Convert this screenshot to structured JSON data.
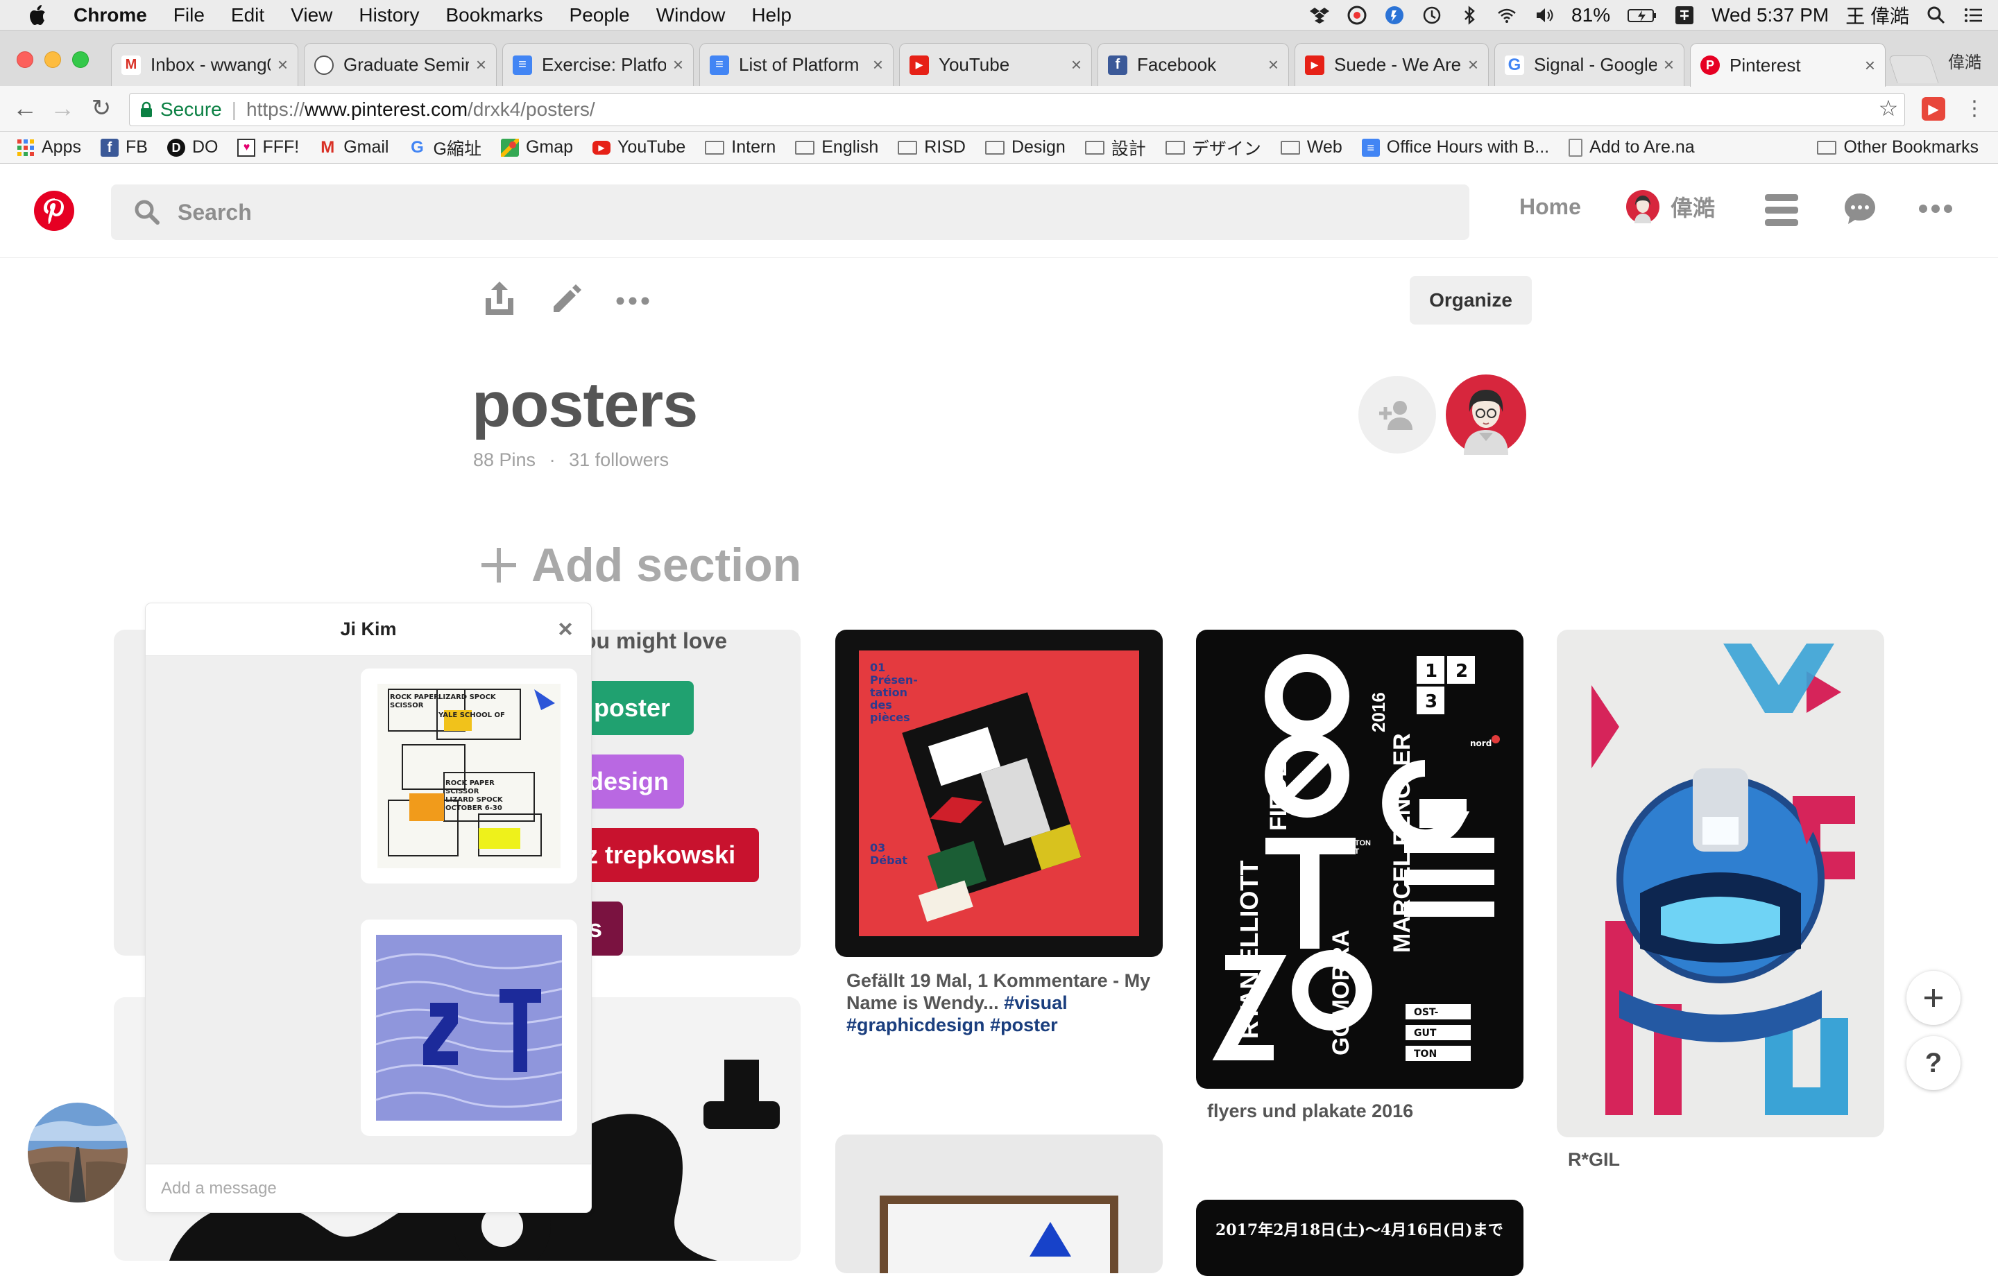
{
  "menubar": {
    "app_name": "Chrome",
    "items": [
      "File",
      "Edit",
      "View",
      "History",
      "Bookmarks",
      "People",
      "Window",
      "Help"
    ],
    "battery": "81%",
    "clock": "Wed 5:37 PM",
    "user": "王 偉澔"
  },
  "tabs": [
    {
      "label": "Inbox - wwang0",
      "icon": "gmail-icon"
    },
    {
      "label": "Graduate Semir",
      "icon": "chat-bubble-icon"
    },
    {
      "label": "Exercise: Platfo",
      "icon": "docs-icon"
    },
    {
      "label": "List of Platform",
      "icon": "docs-icon"
    },
    {
      "label": "YouTube",
      "icon": "youtube-icon"
    },
    {
      "label": "Facebook",
      "icon": "facebook-icon"
    },
    {
      "label": "Suede - We Are",
      "icon": "youtube-icon"
    },
    {
      "label": "Signal - Google",
      "icon": "google-icon"
    },
    {
      "label": "Pinterest",
      "icon": "pinterest-icon",
      "active": true
    }
  ],
  "profile_label": "偉澔",
  "omnibox": {
    "secure_label": "Secure",
    "url_scheme": "https://",
    "url_host": "www.pinterest.com",
    "url_path": "/drxk4/posters/"
  },
  "bookmarks": [
    {
      "label": "Apps",
      "icon": "apps-grid-icon"
    },
    {
      "label": "FB",
      "icon": "facebook-icon"
    },
    {
      "label": "DO",
      "icon": "do-icon"
    },
    {
      "label": "FFF!",
      "icon": "fff-icon"
    },
    {
      "label": "Gmail",
      "icon": "gmail-icon"
    },
    {
      "label": "G縮址",
      "icon": "google-icon"
    },
    {
      "label": "Gmap",
      "icon": "maps-icon"
    },
    {
      "label": "YouTube",
      "icon": "youtube-icon"
    },
    {
      "label": "Intern",
      "icon": "folder-icon"
    },
    {
      "label": "English",
      "icon": "folder-icon"
    },
    {
      "label": "RISD",
      "icon": "folder-icon"
    },
    {
      "label": "Design",
      "icon": "folder-icon"
    },
    {
      "label": "設計",
      "icon": "folder-icon"
    },
    {
      "label": "デザイン",
      "icon": "folder-icon"
    },
    {
      "label": "Web",
      "icon": "folder-icon"
    },
    {
      "label": "Office Hours with B...",
      "icon": "docs-icon"
    },
    {
      "label": "Add to Are.na",
      "icon": "page-icon"
    }
  ],
  "other_bookmarks": "Other Bookmarks",
  "pinterest": {
    "search_placeholder": "Search",
    "nav_home": "Home",
    "user_name": "偉澔",
    "organize": "Organize",
    "board_title": "posters",
    "pins_count": "88 Pins",
    "followers": "31 followers",
    "add_section": "Add section",
    "ideas_heading": "ou might love",
    "tags": [
      "poster",
      "design",
      "z trepkowski",
      "s"
    ],
    "pins": [
      {
        "caption_plain": "Gefällt 19 Mal, 1 Kommentare - My Name is Wendy...",
        "hashtags": [
          "#visual",
          "#graphicdesign",
          "#poster"
        ]
      },
      {
        "caption": "flyers und plakate 2016"
      },
      {
        "caption": "R*GIL"
      }
    ],
    "poster_text": {
      "p2_names": [
        "RYAN ELLIOTT",
        "FIEDEL",
        "GOMORRA",
        "MARCEL FENGLER"
      ],
      "p2_year": "2016",
      "p2_small": "OSTGUT TON NACHT",
      "p4_date": "2017年2月18日(土)〜4月16日(日)まで"
    }
  },
  "chat": {
    "title": "Ji Kim",
    "input_placeholder": "Add a message"
  },
  "colors": {
    "pinterest_red": "#e60023",
    "tag_green": "#20a170",
    "tag_purple": "#b968e2",
    "tag_red": "#c8122e",
    "tag_maroon": "#7a1240",
    "hashtag_blue": "#1a3e7e"
  }
}
